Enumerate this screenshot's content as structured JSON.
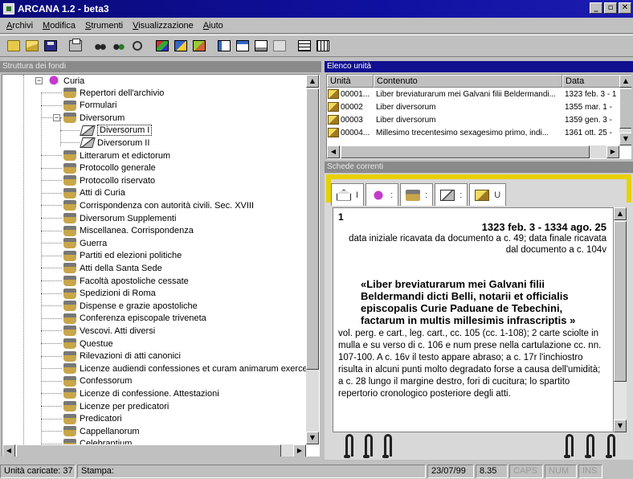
{
  "window": {
    "title": "ARCANA 1.2 - beta3",
    "buttons": [
      "_",
      "▫",
      "✕"
    ]
  },
  "menu": [
    "Archivi",
    "Modifica",
    "Strumenti",
    "Visualizzazione",
    "Aiuto"
  ],
  "toolbar": {
    "icons": [
      "folder-icon",
      "open-folder-icon",
      "save-icon",
      "print-icon",
      "find-icon",
      "find-next-icon",
      "zoom-icon",
      "color-palette-icon",
      "color-fill-icon",
      "color-brush-icon",
      "view-left-icon",
      "view-top-icon",
      "view-bottom-icon",
      "view-disabled-icon",
      "grid-rows-icon",
      "grid-cols-icon"
    ]
  },
  "tree": {
    "header": "Struttura dei fondi",
    "root": "Curia",
    "items": [
      {
        "label": "Repertori dell'archivio",
        "level": 2,
        "icon": "series"
      },
      {
        "label": "Formulari",
        "level": 2,
        "icon": "series"
      },
      {
        "label": "Diversorum",
        "level": 2,
        "icon": "series",
        "expanded": true
      },
      {
        "label": "Diversorum I",
        "level": 3,
        "icon": "book",
        "selected": true
      },
      {
        "label": "Diversorum II",
        "level": 3,
        "icon": "book"
      },
      {
        "label": "Litterarum et edictorum",
        "level": 2,
        "icon": "series"
      },
      {
        "label": "Protocollo generale",
        "level": 2,
        "icon": "series"
      },
      {
        "label": "Protocollo riservato",
        "level": 2,
        "icon": "series"
      },
      {
        "label": "Atti di Curia",
        "level": 2,
        "icon": "series"
      },
      {
        "label": "Corrispondenza con autorità civili. Sec. XVIII",
        "level": 2,
        "icon": "series"
      },
      {
        "label": "Diversorum Supplementi",
        "level": 2,
        "icon": "series"
      },
      {
        "label": "Miscellanea. Corrispondenza",
        "level": 2,
        "icon": "series"
      },
      {
        "label": "Guerra",
        "level": 2,
        "icon": "series"
      },
      {
        "label": "Partiti ed elezioni politiche",
        "level": 2,
        "icon": "series"
      },
      {
        "label": "Atti della Santa Sede",
        "level": 2,
        "icon": "series"
      },
      {
        "label": "Facoltà apostoliche cessate",
        "level": 2,
        "icon": "series"
      },
      {
        "label": "Spedizioni di Roma",
        "level": 2,
        "icon": "series"
      },
      {
        "label": "Dispense e grazie apostoliche",
        "level": 2,
        "icon": "series"
      },
      {
        "label": "Conferenza episcopale triveneta",
        "level": 2,
        "icon": "series"
      },
      {
        "label": "Vescovi. Atti diversi",
        "level": 2,
        "icon": "series"
      },
      {
        "label": "Questue",
        "level": 2,
        "icon": "series"
      },
      {
        "label": "Rilevazioni di atti canonici",
        "level": 2,
        "icon": "series"
      },
      {
        "label": "Licenze audiendi confessiones et curam animarum exercer",
        "level": 2,
        "icon": "series"
      },
      {
        "label": "Confessorum",
        "level": 2,
        "icon": "series"
      },
      {
        "label": "Licenze di confessione. Attestazioni",
        "level": 2,
        "icon": "series"
      },
      {
        "label": "Licenze per predicatori",
        "level": 2,
        "icon": "series"
      },
      {
        "label": "Predicatori",
        "level": 2,
        "icon": "series"
      },
      {
        "label": "Cappellanorum",
        "level": 2,
        "icon": "series"
      },
      {
        "label": "Celebrantium",
        "level": 2,
        "icon": "series"
      }
    ]
  },
  "unit_list": {
    "header": "Elenco unità",
    "columns": [
      "Unità",
      "Contenuto",
      "Data"
    ],
    "rows": [
      {
        "unit": "00001...",
        "content": "Liber breviaturarum mei Galvani filii Beldermandi...",
        "date": "1323 feb. 3 - 1"
      },
      {
        "unit": "00002",
        "content": "Liber diversorum",
        "date": "1355 mar. 1 -"
      },
      {
        "unit": "00003",
        "content": "Liber diversorum",
        "date": "1359 gen. 3 -"
      },
      {
        "unit": "00004...",
        "content": "Millesimo trecentesimo sexagesimo primo, indi...",
        "date": "1361 ott. 25 -"
      }
    ]
  },
  "scheda": {
    "header": "Schede correnti",
    "tabs": [
      {
        "icon": "house-icon",
        "letter": "I"
      },
      {
        "icon": "curia-icon",
        "letter": ":"
      },
      {
        "icon": "series-icon",
        "letter": ":"
      },
      {
        "icon": "book-icon",
        "letter": ":"
      },
      {
        "icon": "unit-icon",
        "letter": "U"
      }
    ],
    "number": "1",
    "dates": "1323 feb. 3 - 1334 ago. 25",
    "note": "data iniziale ricavata da documento a c. 49; data finale ricavata dal documento a c. 104v",
    "title": "«Liber breviaturarum mei Galvani filii Beldermandi dicti Belli, notarii et officialis episcopalis Curie Paduane de Tebechini, factarum in multis millesimis infrascriptis »",
    "description": "vol. perg. e cart., leg. cart., cc. 105 (cc. 1-108); 2 carte sciolte in mulla e su verso di c. 106 e num prese nella cartulazione cc. nn. 107-100. A c. 16v il testo appare abraso; a c. 17r l'inchiostro risulta in alcuni punti molto degradato forse a causa dell'umidità; a c. 28 lungo il margine destro, fori di cucitura; lo spartito repertorio cronologico posteriore degli atti."
  },
  "status": {
    "units": "Unità caricate: 37",
    "print": "Stampa:",
    "date": "23/07/99",
    "time": "8.35",
    "caps": "CAPS",
    "num": "NUM",
    "ins": "INS"
  }
}
